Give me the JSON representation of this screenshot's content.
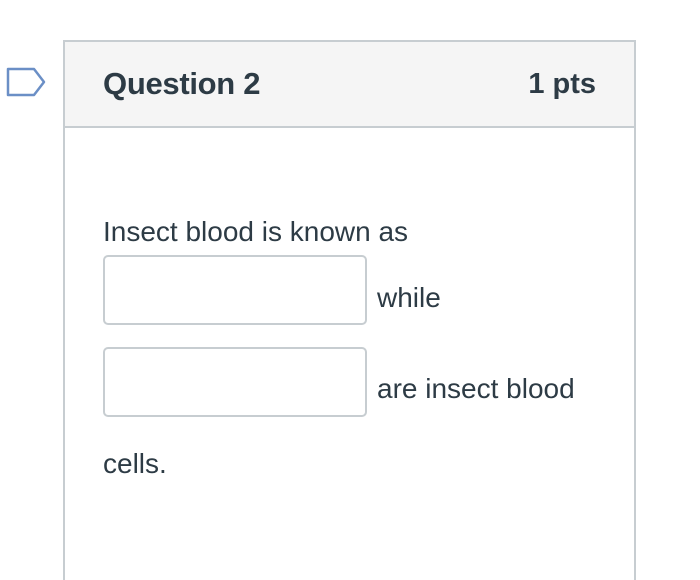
{
  "question": {
    "title": "Question 2",
    "points": "1 pts",
    "flag_icon": "flag-outline-icon",
    "text_before_blank1": "Insect blood is known as",
    "blank1_value": "",
    "text_after_blank1": "while",
    "blank2_value": "",
    "text_after_blank2": "are insect blood",
    "text_end": "cells."
  },
  "colors": {
    "border": "#c7cdd1",
    "header_bg": "#f5f5f5",
    "text": "#2d3b45",
    "flag": "#6b8fc6"
  }
}
